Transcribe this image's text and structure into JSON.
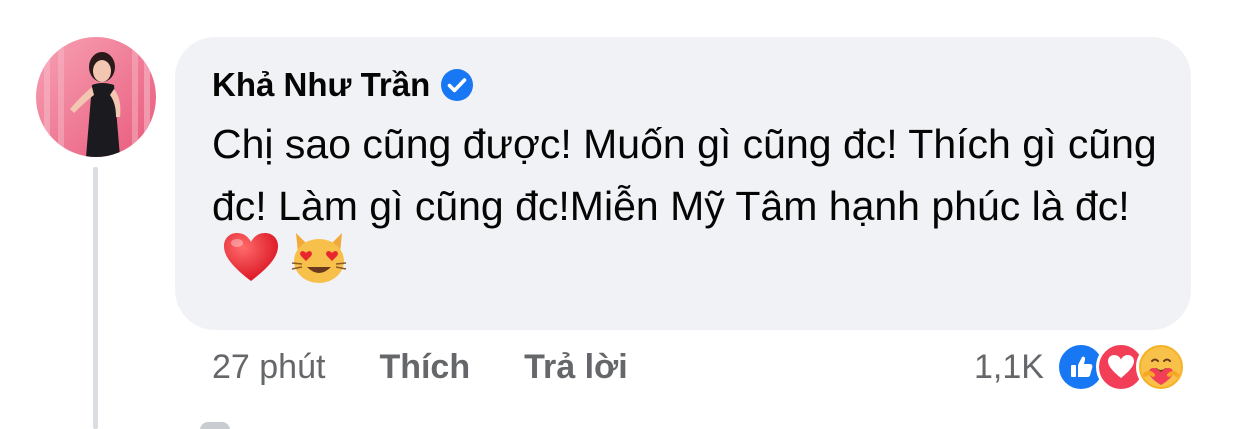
{
  "comment": {
    "author": "Khả Như Trần",
    "verified": true,
    "text": "Chị sao cũng được! Muốn gì cũng đc! Thích gì cũng đc! Làm gì cũng đc!Miễn Mỹ Tâm hạnh phúc là đc!",
    "emojis": [
      "red-heart-icon",
      "heart-eyes-cat-icon"
    ]
  },
  "meta": {
    "time": "27 phút",
    "like_label": "Thích",
    "reply_label": "Trả lời"
  },
  "reactions": {
    "count": "1,1K",
    "icons": [
      "like-reaction-icon",
      "love-reaction-icon",
      "care-reaction-icon"
    ]
  },
  "colors": {
    "bubble": "#f0f2f5",
    "meta_text": "#65676b",
    "verified": "#1877f2",
    "like": "#1877f2",
    "love": "#f33e58",
    "care": "#f7b125"
  }
}
